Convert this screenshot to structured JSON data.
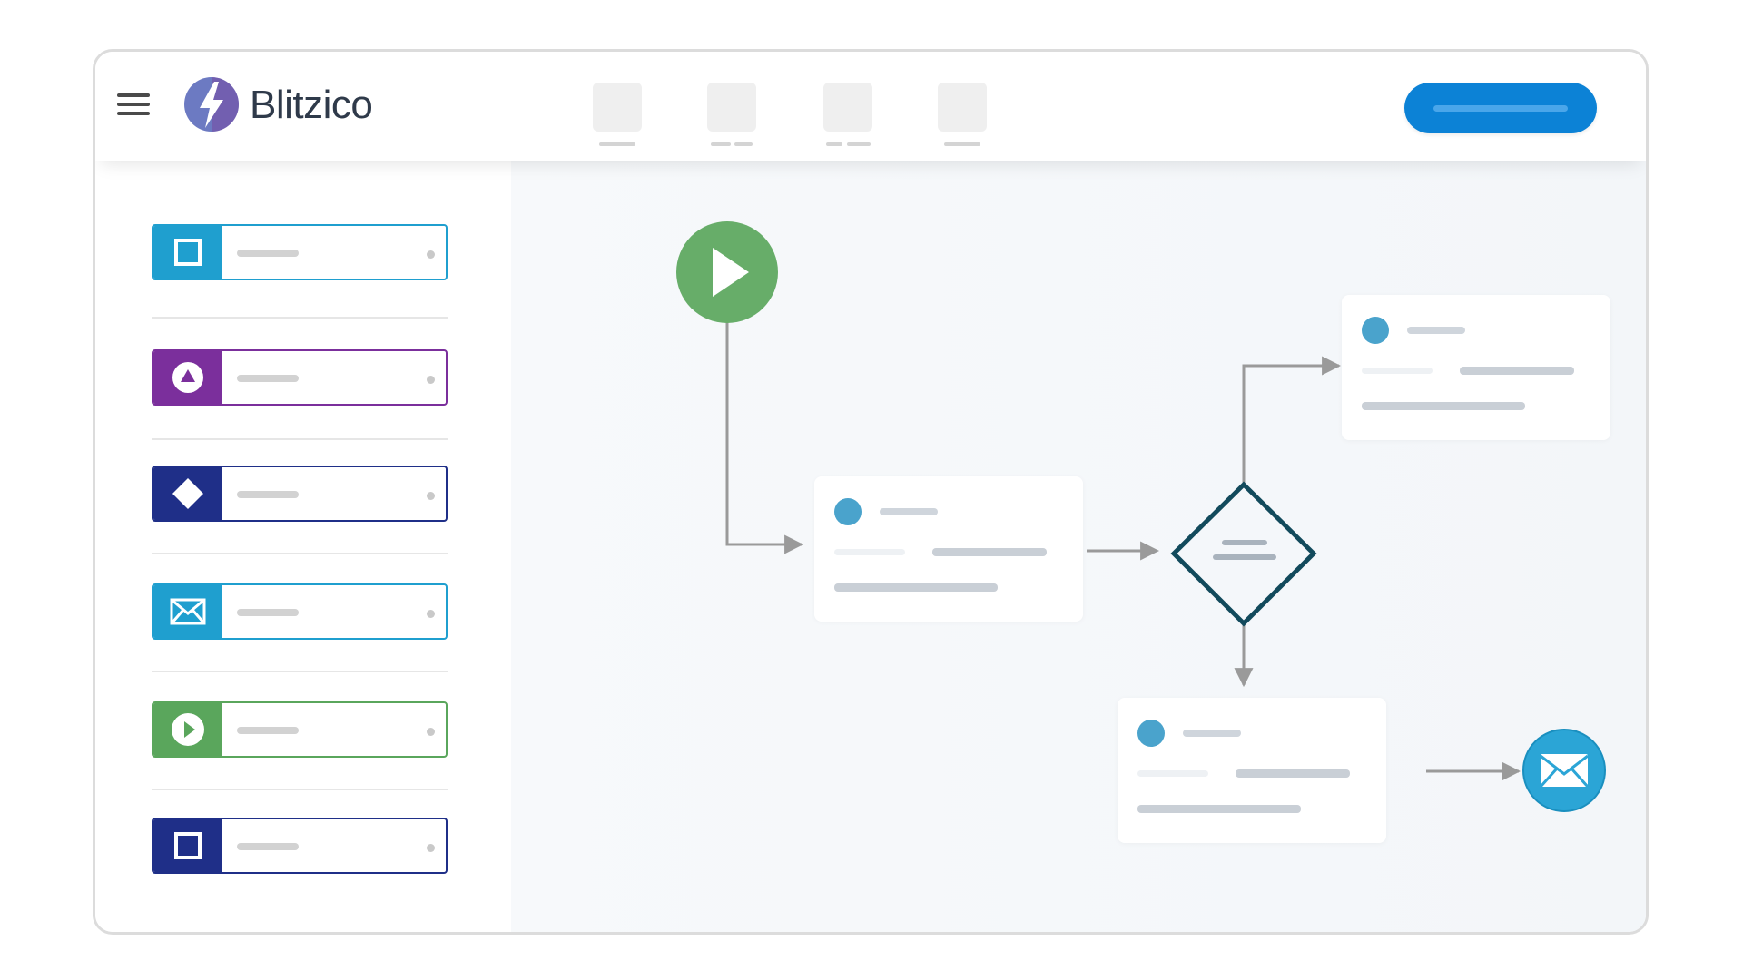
{
  "app": {
    "brand_name": "Blitzico",
    "logo_icon": "lightning-bolt-icon",
    "colors": {
      "primary": "#0c82d6",
      "start": "#67ad69",
      "decision": "#124a5c",
      "accent": "#2ba5d6"
    }
  },
  "header": {
    "menu_icon": "hamburger-menu-icon",
    "nav_tabs": [
      {
        "icon": "placeholder-icon"
      },
      {
        "icon": "placeholder-icon"
      },
      {
        "icon": "placeholder-icon"
      },
      {
        "icon": "placeholder-icon"
      }
    ]
  },
  "sidebar": {
    "items": [
      {
        "icon": "square-task-icon",
        "color": "#1f9fcf"
      },
      {
        "icon": "triangle-event-icon",
        "color": "#7b2f9c"
      },
      {
        "icon": "diamond-gateway-icon",
        "color": "#1f2f88"
      },
      {
        "icon": "envelope-icon",
        "color": "#1f9fcf"
      },
      {
        "icon": "play-start-icon",
        "color": "#5aa65c"
      },
      {
        "icon": "square-end-icon",
        "color": "#1f2f88"
      }
    ]
  },
  "canvas": {
    "nodes": [
      {
        "id": "start",
        "icon": "play-icon"
      },
      {
        "id": "task-1"
      },
      {
        "id": "decision",
        "icon": "diamond-icon"
      },
      {
        "id": "task-2"
      },
      {
        "id": "task-3"
      },
      {
        "id": "end-email",
        "icon": "envelope-icon"
      }
    ]
  }
}
